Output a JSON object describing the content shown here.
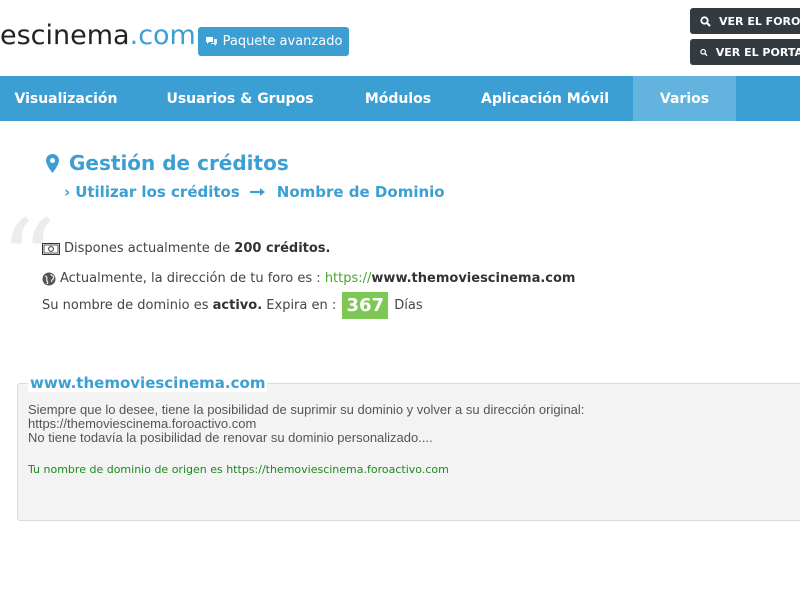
{
  "header": {
    "logo_main": "escinema",
    "logo_tld": ".com",
    "package_button": "Paquete avanzado",
    "view_forum": "VER EL FORO",
    "view_portal": "VER EL PORTAL"
  },
  "nav": {
    "items": [
      "Visualización",
      "Usuarios & Grupos",
      "Módulos",
      "Aplicación Móvil",
      "Varios"
    ],
    "active_index": 4
  },
  "page": {
    "title": "Gestión de créditos",
    "breadcrumb_1": "Utilizar los créditos",
    "breadcrumb_2": "Nombre de Dominio"
  },
  "info": {
    "credits_prefix": "Dispones actualmente de",
    "credits_value": "200 créditos.",
    "address_prefix": "Actualmente, la dirección de tu foro es :",
    "address_scheme": "https://",
    "address_host": "www.themoviescinema.com",
    "status_prefix": "Su nombre de dominio es",
    "status_value": "activo.",
    "expire_prefix": "Expira en :",
    "expire_days": "367",
    "expire_unit": "Días"
  },
  "domain_box": {
    "title": "www.themoviescinema.com",
    "line1": "Siempre que lo desee, tiene la posibilidad de suprimir su dominio y volver a su dirección original:",
    "line2": "https://themoviescinema.foroactivo.com",
    "line3": "No tiene todavía la posibilidad de renovar su dominio personalizado....",
    "origin": "Tu nombre de dominio de origen es https://themoviescinema.foroactivo.com"
  },
  "colors": {
    "accent": "#3c9fd4",
    "nav_active": "#62b4de",
    "badge": "#7dc855",
    "link_green": "#4aa52e",
    "origin_green": "#1c8a1c",
    "dark_button": "#333a40"
  }
}
